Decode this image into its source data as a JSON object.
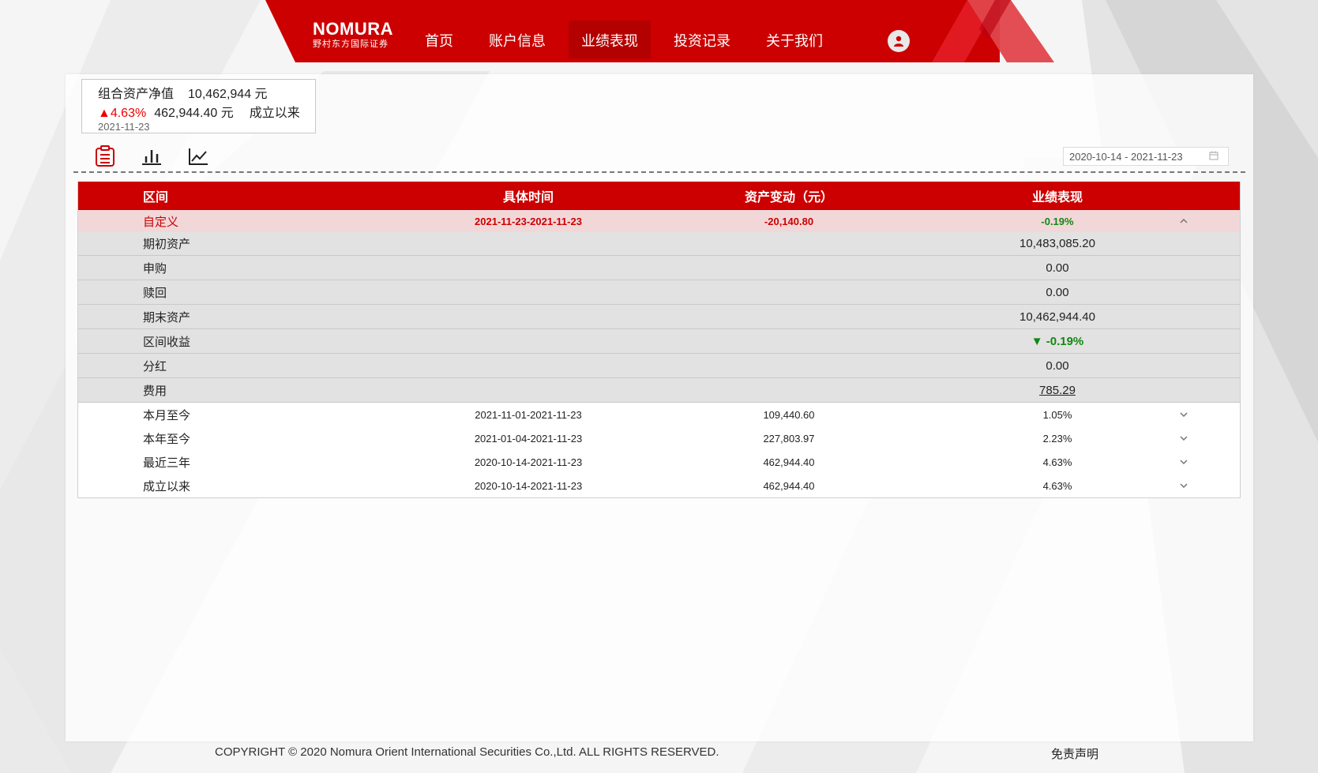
{
  "header": {
    "brand": "NOMURA",
    "brand_sub": "野村东方国际证券",
    "nav": [
      {
        "label": "首页"
      },
      {
        "label": "账户信息"
      },
      {
        "label": "业绩表现"
      },
      {
        "label": "投资记录"
      },
      {
        "label": "关于我们"
      }
    ],
    "active_index": 2,
    "user_icon": "user-icon"
  },
  "summary": {
    "nav_label": "组合资产净值",
    "nav_value": "10,462,944 元",
    "change_pct": "▲4.63%",
    "change_amount": "462,944.40 元",
    "change_since": "成立以来",
    "date": "2021-11-23"
  },
  "view_icons": [
    "table-view-icon",
    "bar-chart-icon",
    "line-chart-icon"
  ],
  "date_range": "2020-10-14 - 2021-11-23",
  "table": {
    "headers": [
      "区间",
      "具体时间",
      "资产变动（元）",
      "业绩表现"
    ],
    "custom_row": {
      "label": "自定义",
      "period": "2021-11-23-2021-11-23",
      "change": "-20,140.80",
      "performance": "-0.19%"
    },
    "details": [
      {
        "label": "期初资产",
        "value": "10,483,085.20"
      },
      {
        "label": "申购",
        "value": "0.00"
      },
      {
        "label": "赎回",
        "value": "0.00"
      },
      {
        "label": "期末资产",
        "value": "10,462,944.40"
      },
      {
        "label": "区间收益",
        "value": "▼ -0.19%"
      },
      {
        "label": "分红",
        "value": "0.00"
      },
      {
        "label": "费用",
        "value": "785.29"
      }
    ],
    "periods": [
      {
        "label": "本月至今",
        "period": "2021-11-01-2021-11-23",
        "change": "109,440.60",
        "performance": "1.05%"
      },
      {
        "label": "本年至今",
        "period": "2021-01-04-2021-11-23",
        "change": "227,803.97",
        "performance": "2.23%"
      },
      {
        "label": "最近三年",
        "period": "2020-10-14-2021-11-23",
        "change": "462,944.40",
        "performance": "4.63%"
      },
      {
        "label": "成立以来",
        "period": "2020-10-14-2021-11-23",
        "change": "462,944.40",
        "performance": "4.63%"
      }
    ]
  },
  "footer": {
    "copyright": "COPYRIGHT © 2020 Nomura Orient International Securities Co.,Ltd. ALL RIGHTS RESERVED.",
    "disclaimer": "免责声明"
  },
  "colors": {
    "brand_red": "#cc0000",
    "positive": "#e00000",
    "negative": "#118811"
  }
}
